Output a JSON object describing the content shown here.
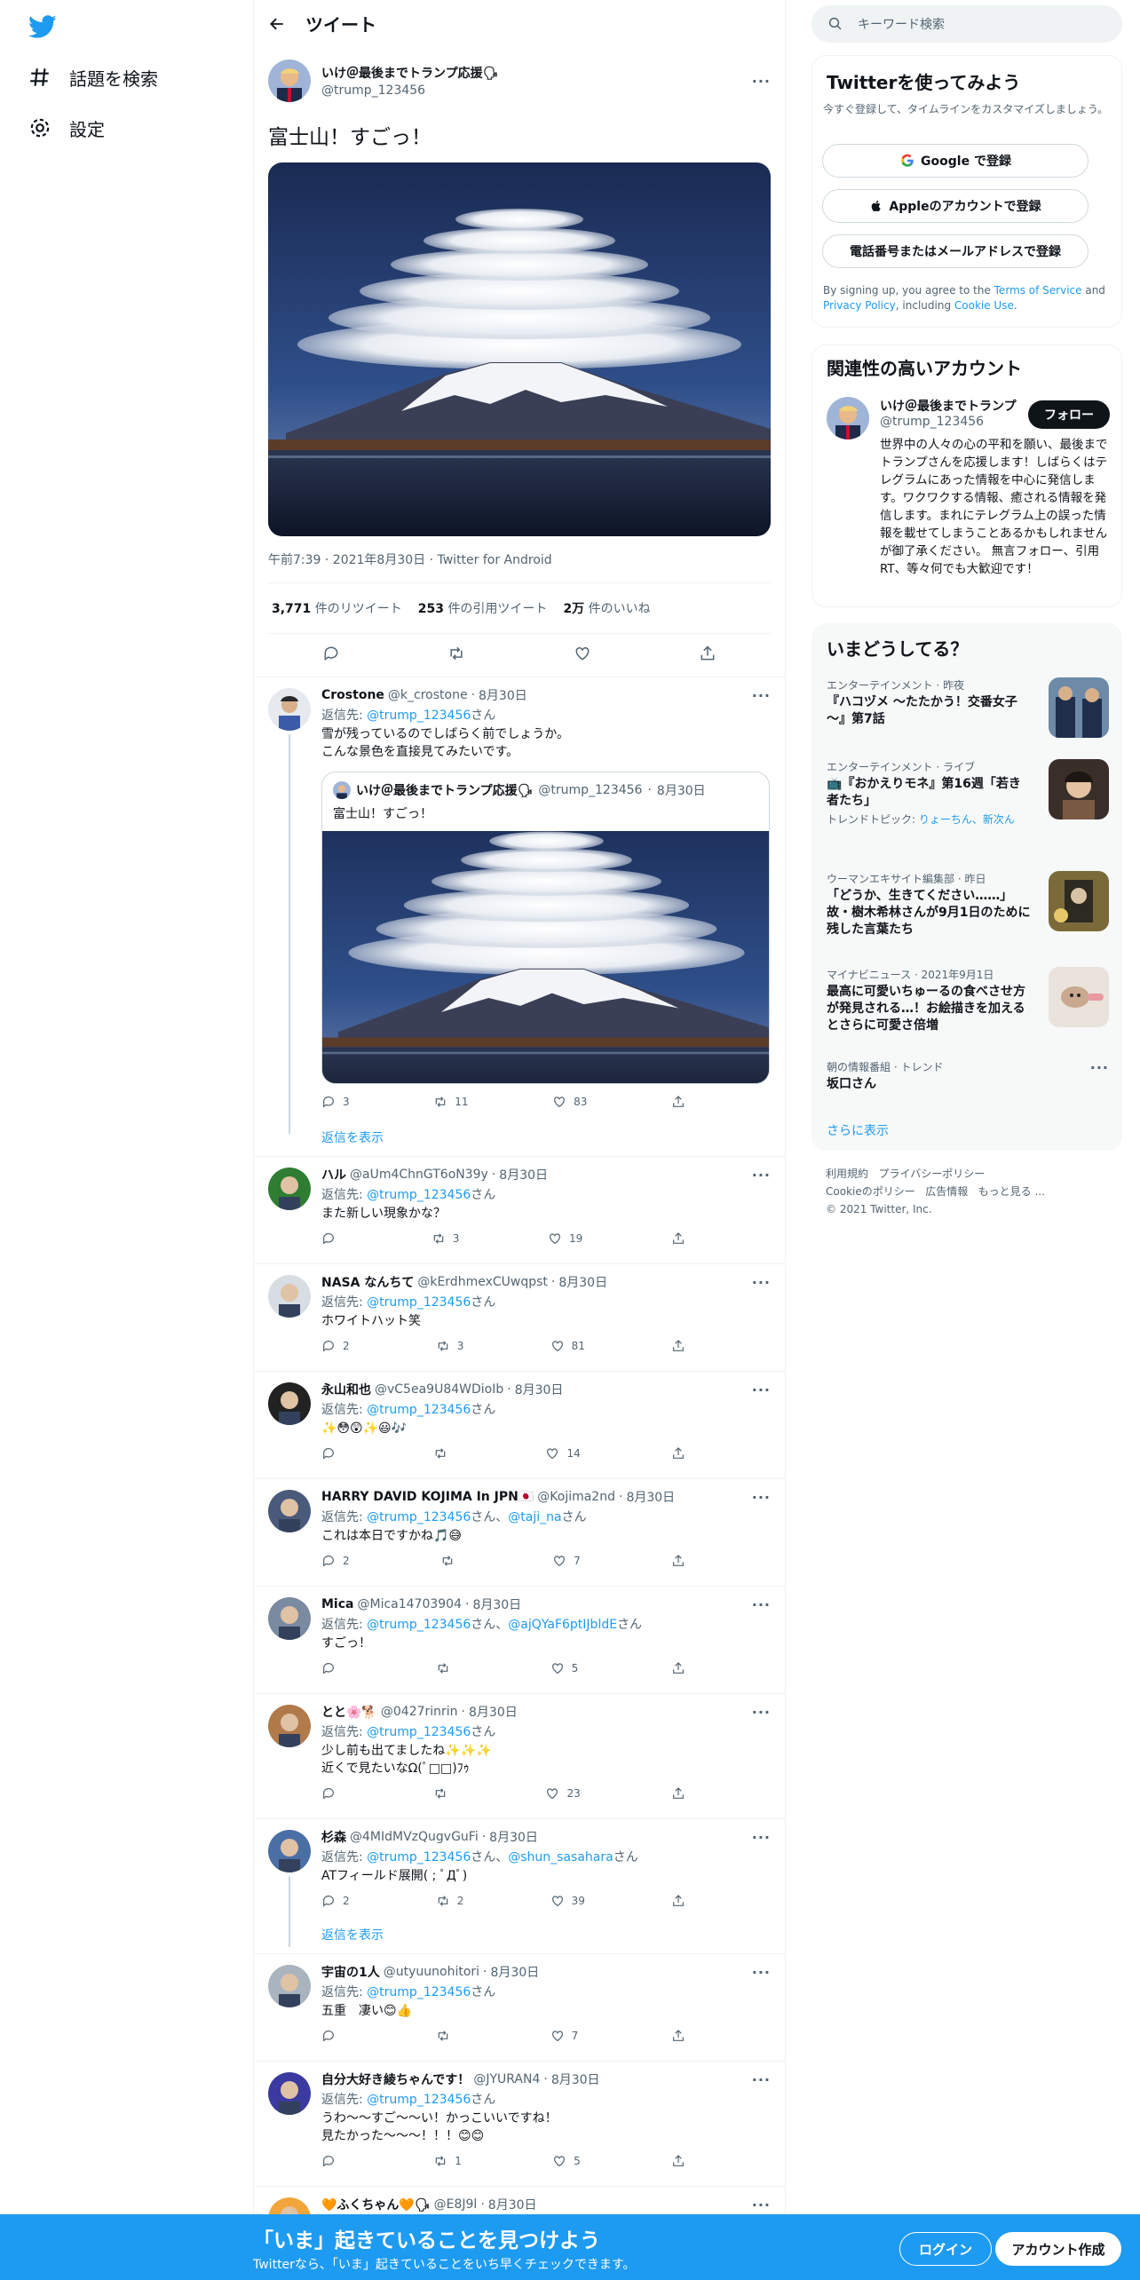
{
  "nav": {
    "explore_label": "話題を検索",
    "settings_label": "設定"
  },
  "header": {
    "title": "ツイート"
  },
  "main_tweet": {
    "name": "いけ＠最後までトランプ応援🗣",
    "handle": "@trump_123456",
    "text": "富士山！すごっ！",
    "meta": "午前7:39 · 2021年8月30日 · Twitter for Android",
    "retweets": "3,771",
    "retweets_label": "件のリツイート",
    "quotes": "253",
    "quotes_label": "件の引用ツイート",
    "likes": "2万",
    "likes_label": "件のいいね"
  },
  "replies": [
    {
      "name": "Crostone",
      "handle": "@k_crostone",
      "date": "8月30日",
      "to_prefix": "返信先: ",
      "to": "@trump_123456",
      "to_suffix": "さん",
      "text1": "雪が残っているのでしばらく前でしょうか。",
      "text2": "こんな景色を直接見てみたいです。",
      "replies": "3",
      "retweets": "11",
      "likes": "83",
      "quote": {
        "name": "いけ＠最後までトランプ応援🗣",
        "handle": "@trump_123456",
        "date": "8月30日",
        "text": "富士山！すごっ！"
      }
    },
    {
      "name": "ハル",
      "handle": "@aUm4ChnGT6oN39y",
      "date": "8月30日",
      "to_prefix": "返信先: ",
      "to": "@trump_123456",
      "to_suffix": "さん",
      "text1": "また新しい現象かな？",
      "replies": "",
      "retweets": "3",
      "likes": "19"
    },
    {
      "name": "NASA なんちて",
      "handle": "@kErdhmexCUwqpst",
      "date": "8月30日",
      "to_prefix": "返信先: ",
      "to": "@trump_123456",
      "to_suffix": "さん",
      "text1": "ホワイトハット笑",
      "replies": "2",
      "retweets": "3",
      "likes": "81"
    },
    {
      "name": "永山和也",
      "handle": "@vC5ea9U84WDioIb",
      "date": "8月30日",
      "to_prefix": "返信先: ",
      "to": "@trump_123456",
      "to_suffix": "さん",
      "text1": "✨😳😲✨😃🎶",
      "replies": "",
      "retweets": "",
      "likes": "14"
    },
    {
      "name": "HARRY DAVID KOJIMA In JPN🇯🇵",
      "handle": "@Kojima2nd",
      "date": "8月30日",
      "to_prefix": "返信先: ",
      "to": "@trump_123456",
      "to_mid": "さん、",
      "to2": "@taji_na",
      "to_suffix": "さん",
      "text1": "これは本日ですかね🎵😅",
      "replies": "2",
      "retweets": "",
      "likes": "7"
    },
    {
      "name": "Mica",
      "handle": "@Mica14703904",
      "date": "8月30日",
      "to_prefix": "返信先: ",
      "to": "@trump_123456",
      "to_mid": "さん、",
      "to2": "@ajQYaF6ptIJbldE",
      "to_suffix": "さん",
      "text1": "すごっ！",
      "replies": "",
      "retweets": "",
      "likes": "5"
    },
    {
      "name": "とと🌸🐕",
      "handle": "@0427rinrin",
      "date": "8月30日",
      "to_prefix": "返信先: ",
      "to": "@trump_123456",
      "to_suffix": "さん",
      "text1": "少し前も出てましたね✨✨✨",
      "text2": "近くで見たいなΩ(ﾟ□□)ﾌｩ",
      "replies": "",
      "retweets": "",
      "likes": "23"
    },
    {
      "name": "杉森",
      "handle": "@4MIdMVzQugvGuFi",
      "date": "8月30日",
      "to_prefix": "返信先: ",
      "to": "@trump_123456",
      "to_mid": "さん、",
      "to2": "@shun_sasahara",
      "to_suffix": "さん",
      "text1": "ATフィールド展開( ; ﾟДﾟ)",
      "replies": "2",
      "retweets": "2",
      "likes": "39"
    },
    {
      "name": "宇宙の1人",
      "handle": "@utyuunohitori",
      "date": "8月30日",
      "to_prefix": "返信先: ",
      "to": "@trump_123456",
      "to_suffix": "さん",
      "text1": "五重　凄い😊👍",
      "replies": "",
      "retweets": "",
      "likes": "7"
    },
    {
      "name": "自分大好き綾ちゃんです！",
      "handle": "@JYURAN4",
      "date": "8月30日",
      "to_prefix": "返信先: ",
      "to": "@trump_123456",
      "to_suffix": "さん",
      "text1": "うわ～～すご～～い！かっこいいですね！",
      "text2": "見たかった～～～！！！😊😊",
      "replies": "",
      "retweets": "1",
      "likes": "5"
    },
    {
      "name": "🧡ふくちゃん🧡🗣",
      "handle": "@E8J9l",
      "date": "8月30日"
    }
  ],
  "show_replies": "返信を表示",
  "search": {
    "placeholder": "キーワード検索"
  },
  "signup_panel": {
    "title": "Twitterを使ってみよう",
    "desc": "今すぐ登録して、タイムラインをカスタマイズしましょう。",
    "google": "Google で登録",
    "apple": "Appleのアカウントで登録",
    "phone": "電話番号またはメールアドレスで登録",
    "legal1": "By signing up, you agree to the ",
    "terms": "Terms of Service",
    "legal2": " and ",
    "privacy": "Privacy Policy",
    "legal3": ", including ",
    "cookie": "Cookie Use",
    "legal4": "."
  },
  "relevant": {
    "title": "関連性の高いアカウント",
    "name": "いけ＠最後までトランプ",
    "handle": "@trump_123456",
    "follow": "フォロー",
    "bio": "世界中の人々の心の平和を願い、最後までトランプさんを応援します！しばらくはテレグラムにあった情報を中心に発信します。ワクワクする情報、癒される情報を発信します。まれにテレグラム上の誤った情報を載せてしまうことあるかもしれませんが御了承ください。 無言フォロー、引用RT、等々何でも大歓迎です！"
  },
  "trends": {
    "title": "いまどうしてる？",
    "items": [
      {
        "meta": "エンターテインメント · 昨夜",
        "title": "『ハコヅメ ～たたかう！交番女子～』第7話"
      },
      {
        "meta": "エンターテインメント · ライブ",
        "title": "📺『おかえりモネ』第16週「若き者たち」",
        "sub1": "トレンドトピック: ",
        "sub2": "りょーちん、新次ん"
      },
      {
        "meta": "ウーマンエキサイト編集部 · 昨日",
        "title": "「どうか、生きてください……」故・樹木希林さんが9月1日のために残した言葉たち"
      },
      {
        "meta": "マイナビニュース · 2021年9月1日",
        "title": "最高に可愛いちゅーるの食べさせ方が発見される…！お絵描きを加えるとさらに可愛さ倍増"
      },
      {
        "meta": "朝の情報番組 · トレンド",
        "title": "坂口さん"
      }
    ],
    "more": "さらに表示"
  },
  "footer": {
    "line1a": "利用規約",
    "line1b": "プライバシーポリシー",
    "line2a": "Cookieのポリシー",
    "line2b": "広告情報",
    "line2c": "もっと見る ...",
    "copyright": "© 2021 Twitter, Inc."
  },
  "bottom": {
    "title": "「いま」起きていることを見つけよう",
    "sub": "Twitterなら、「いま」起きていることをいち早くチェックできます。",
    "login": "ログイン",
    "signup": "アカウント作成"
  }
}
